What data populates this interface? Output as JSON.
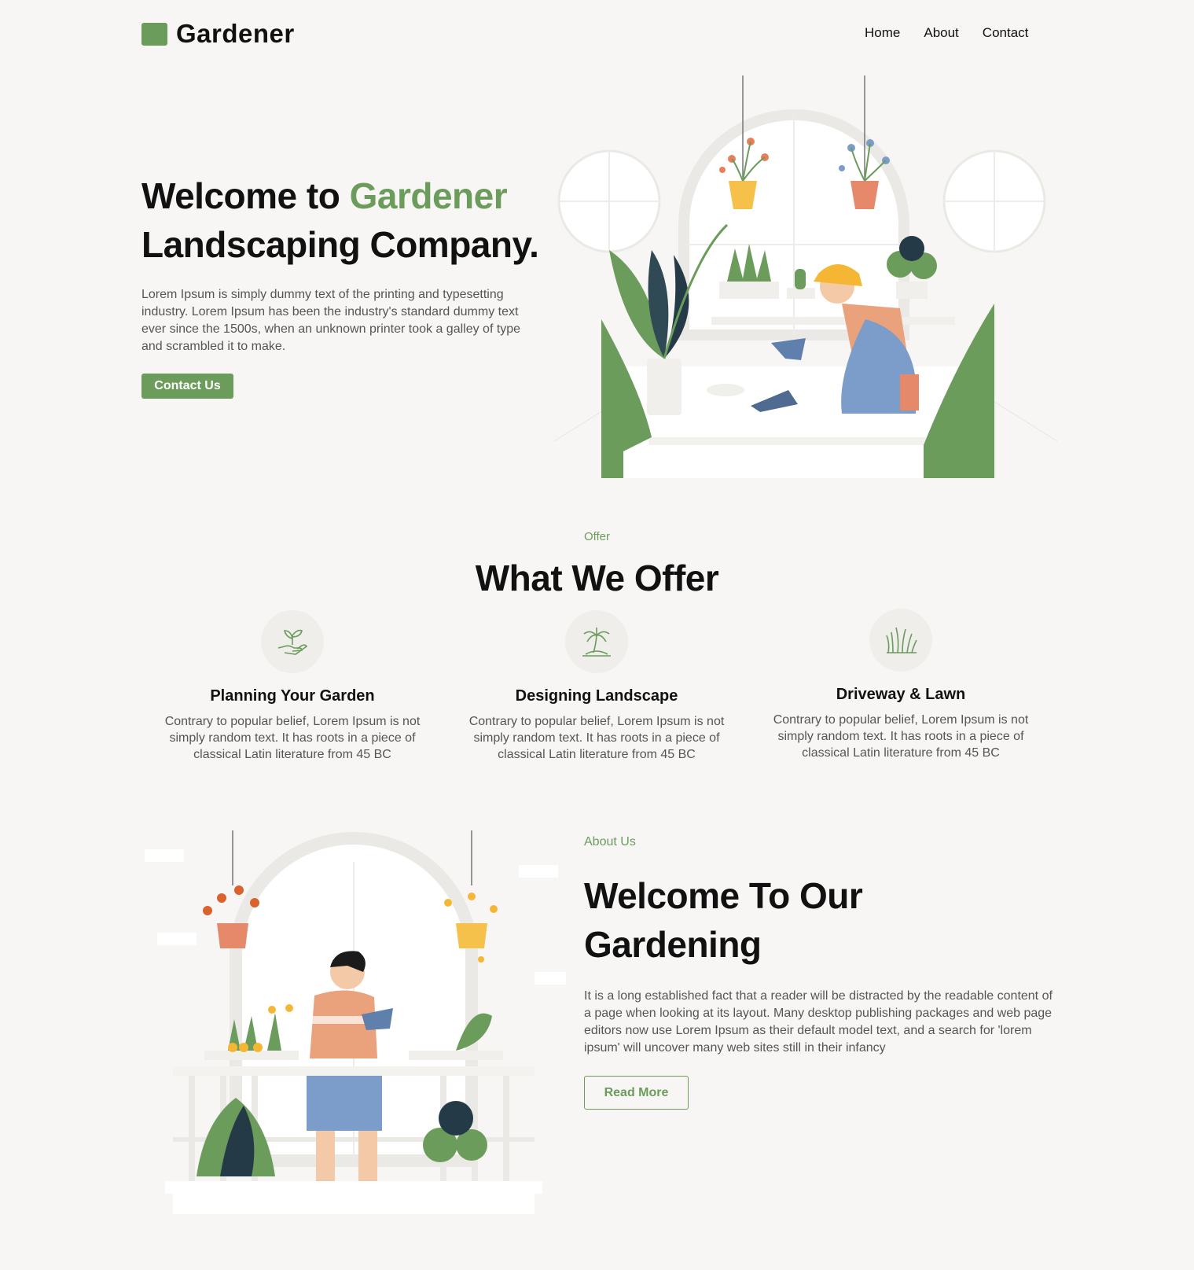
{
  "header": {
    "logo_text": "Gardener",
    "nav": [
      "Home",
      "About",
      "Contact"
    ]
  },
  "hero": {
    "title_prefix": "Welcome to ",
    "title_accent": "Gardener",
    "title_line2": "Landscaping Company.",
    "description": "Lorem Ipsum is simply dummy text of the printing and typesetting industry. Lorem Ipsum has been the industry's standard dummy text ever since the 1500s, when an unknown printer took a galley of type and scrambled it to make.",
    "cta_label": "Contact Us"
  },
  "offer": {
    "kicker": "Offer",
    "title": "What We Offer",
    "cards": [
      {
        "icon": "hand-sprout-icon",
        "title": "Planning Your Garden",
        "text": "Contrary to popular belief, Lorem Ipsum is not simply random text. It has roots in a piece of classical Latin literature from 45 BC"
      },
      {
        "icon": "palm-tree-icon",
        "title": "Designing Landscape",
        "text": "Contrary to popular belief, Lorem Ipsum is not simply random text. It has roots in a piece of classical Latin literature from 45 BC"
      },
      {
        "icon": "grass-icon",
        "title": "Driveway & Lawn",
        "text": "Contrary to popular belief, Lorem Ipsum is not simply random text. It has roots in a piece of classical Latin literature from 45 BC"
      }
    ]
  },
  "about": {
    "kicker": "About Us",
    "title": "Welcome To Our Gardening",
    "description": "It is a long established fact that a reader will be distracted by the readable content of a page when looking at its layout. Many desktop publishing packages and web page editors now use Lorem Ipsum as their default model text, and a search for 'lorem ipsum' will uncover many web sites still in their infancy",
    "cta_label": "Read More"
  },
  "colors": {
    "accent": "#6b9c5c",
    "background": "#f7f6f4",
    "text": "#111111",
    "muted_text": "#555555"
  }
}
